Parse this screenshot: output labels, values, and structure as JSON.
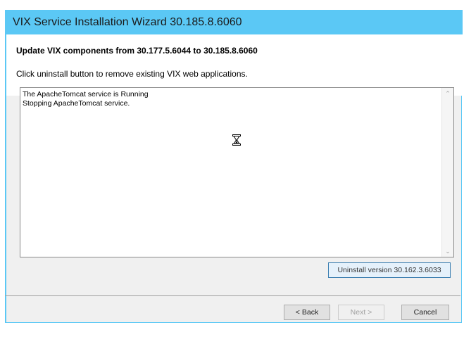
{
  "window": {
    "title": "VIX Service Installation Wizard 30.185.8.6060",
    "accent_color": "#5bc8f5"
  },
  "header": {
    "heading": "Update VIX components from 30.177.5.6044 to 30.185.8.6060",
    "instruction": "Click uninstall button to remove existing VIX web applications."
  },
  "log": {
    "lines": [
      "The ApacheTomcat service is Running",
      "Stopping ApacheTomcat service."
    ],
    "cursor_icon": "hourglass-icon"
  },
  "actions": {
    "uninstall_label": "Uninstall version 30.162.3.6033"
  },
  "footer": {
    "back_label": "< Back",
    "next_label": "Next >",
    "cancel_label": "Cancel"
  }
}
